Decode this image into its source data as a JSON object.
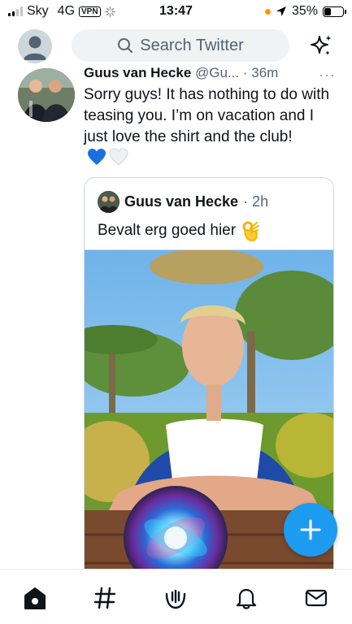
{
  "status_bar": {
    "carrier": "Sky",
    "network": "4G",
    "vpn": "VPN",
    "time": "13:47",
    "battery": "35%",
    "battery_level": 0.35
  },
  "header": {
    "search_placeholder": "Search Twitter"
  },
  "tweet": {
    "author": "Guus van Hecke",
    "handle": "@Gu...",
    "time": "· 36m",
    "more": "···",
    "text": "Sorry guys! It has nothing to do with teasing you. I’m on vacation and I just love the shirt and the club!",
    "emoji": [
      "💙",
      "🤍"
    ],
    "colors": {
      "blue_heart": "#1d6fe0",
      "white_heart": "#eef1f4"
    }
  },
  "quoted_tweet": {
    "author": "Guus van Hecke",
    "time": "· 2h",
    "text": "Bevalt erg goed hier",
    "emoji": "👌"
  },
  "icons": {
    "search": "search-icon",
    "sparkle": "sparkle-icon",
    "compose": "plus-icon",
    "home": "home-icon",
    "explore": "hashtag-icon",
    "spaces": "spaces-icon",
    "notifications": "bell-icon",
    "messages": "mail-icon"
  },
  "colors": {
    "accent": "#1d9bf0",
    "text": "#0f1419",
    "secondary": "#536471"
  }
}
